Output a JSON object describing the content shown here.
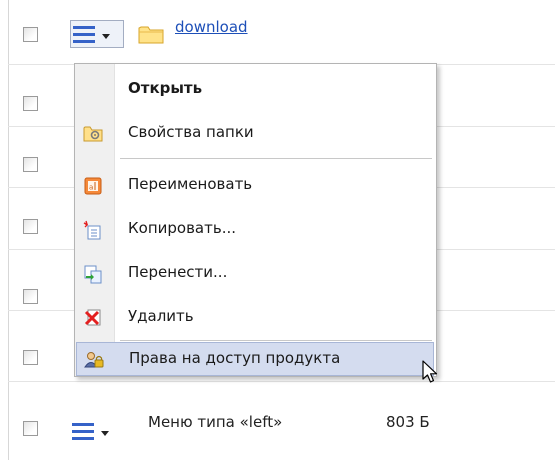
{
  "file_list": {
    "first_row": {
      "name": "download"
    },
    "last_row": {
      "name": "Меню типа «left»",
      "size": "803 Б"
    }
  },
  "context_menu": {
    "items": [
      {
        "label": "Открыть",
        "icon": "none",
        "bold": true
      },
      {
        "label": "Свойства папки",
        "icon": "folder-properties-icon"
      },
      {
        "label": "Переименовать",
        "icon": "rename-icon"
      },
      {
        "label": "Копировать...",
        "icon": "copy-icon"
      },
      {
        "label": "Перенести...",
        "icon": "move-icon"
      },
      {
        "label": "Удалить",
        "icon": "delete-icon"
      },
      {
        "label": "Права на доступ продукта",
        "icon": "access-rights-icon",
        "highlighted": true
      }
    ]
  },
  "colors": {
    "link": "#1d4fb8",
    "highlight": "#d4dcef",
    "accent": "#3562c8"
  }
}
